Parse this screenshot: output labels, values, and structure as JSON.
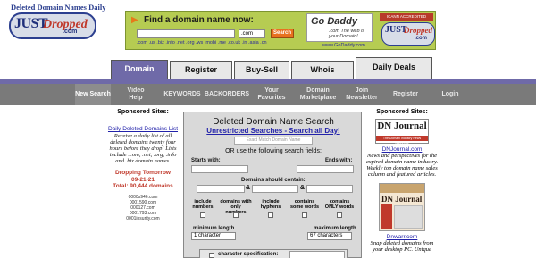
{
  "header": {
    "tagline": "Deleted Domain Names Daily",
    "logo": {
      "just": "JUST",
      "dropped": "Dropped",
      "com": ".com"
    }
  },
  "banner": {
    "title": "Find a domain name now:",
    "tld_select": ".com",
    "search_label": "Search",
    "tlds": ".com .us .biz .info .net .org .ws .mobi .me .co.uk .in .asia .cn",
    "godaddy_logo": "Go Daddy",
    "godaddy_tagline": ".com  The web is your Domain!",
    "godaddy_link": "www.GoDaddy.com",
    "accredited": "ICANN ACCREDITED"
  },
  "tabs": [
    {
      "label": "Domain Search",
      "active": true
    },
    {
      "label": "Register Domain",
      "active": false
    },
    {
      "label": "Buy-Sell",
      "active": false
    },
    {
      "label": "Whois",
      "active": false
    },
    {
      "label": "Daily Deals",
      "active": false
    }
  ],
  "navbar": [
    {
      "label": "New Search",
      "active": true
    },
    {
      "label": "Video Help",
      "active": false
    },
    {
      "label": "KEYWORDS",
      "active": false
    },
    {
      "label": "BACKORDERS",
      "active": false
    },
    {
      "label": "Your Favorites",
      "active": false
    },
    {
      "label": "Domain Marketplace",
      "active": false
    },
    {
      "label": "Join Newsletter",
      "active": false
    },
    {
      "label": "Register",
      "active": false
    },
    {
      "label": "Login",
      "active": false
    }
  ],
  "left": {
    "sponsored": "Sponsored Sites:",
    "link": "Daily Deleted Domains List",
    "desc": "Receive a daily list of all deleted domains twenty four hours before they drop! Lists include .com, .net, .org, .info and .biz domain names.",
    "dropping_label": "Dropping Tomorrow",
    "dropping_date": "09-21-21",
    "total": "Total: 90,444 domains",
    "domains": [
      "0000s946.com",
      "0001590.com",
      "000127.com",
      "0001793.com",
      "0001insurity.com"
    ]
  },
  "search": {
    "title": "Deleted Domain Name Search",
    "subtitle": "Unrestricted Searches - Search all Day!",
    "exact_placeholder": "Exact Match Domain Name",
    "or_text": "OR use the following search fields:",
    "or_bold": "OR",
    "starts_with": "Starts with:",
    "ends_with": "Ends with:",
    "should_contain": "Domains should contain:",
    "amp": "&",
    "options": [
      "include numbers",
      "domains with only numbers",
      "include hyphens",
      "contains some words",
      "contains ONLY words"
    ],
    "min_length_label": "minimum length",
    "min_length_value": "1 character",
    "max_length_label": "maximum length",
    "max_length_value": "67 characters",
    "char_spec": "character specification:"
  },
  "right": {
    "sponsored": "Sponsored Sites:",
    "dnj_title": "DN Journal",
    "dnj_strip": "The Domain Industry News Magazine",
    "dnj_link": "DNJournal.com",
    "dnj_desc": "News and perspectives for the expired domain name industry. Weekly top domain name sales column and featured articles.",
    "dw_title": "DN Journal",
    "dw_link": "Dnwarr.com",
    "dw_desc": "Snap deleted domains from your desktop PC. Unique"
  },
  "colors": {
    "tab_active": "#6f6aa8",
    "navbar": "#7a7a7a",
    "banner": "#b6cc52",
    "link": "#2222aa",
    "alert": "#c0392b"
  }
}
